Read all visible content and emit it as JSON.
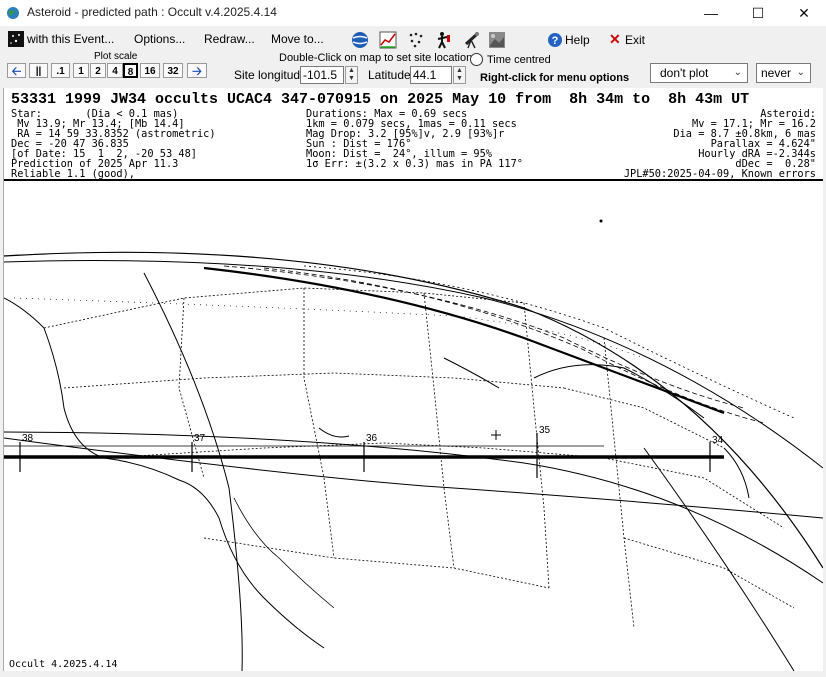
{
  "window": {
    "title": "Asteroid - predicted path : Occult v.4.2025.4.14"
  },
  "menu": {
    "with_event": "with this Event...",
    "options": "Options...",
    "redraw": "Redraw...",
    "move_to": "Move to...",
    "help": "Help",
    "exit": "Exit"
  },
  "controls": {
    "plot_scale_label": "Plot scale",
    "scale_buttons": [
      ".1",
      "1",
      "2",
      "4",
      "8",
      "16",
      "32"
    ],
    "selected_scale": "8",
    "dblclick_hint": "Double-Click on map to set site location",
    "time_centred": "Time centred",
    "site_longitude_label": "Site longitude",
    "site_longitude": "-101.5",
    "latitude_label": "Latitude",
    "latitude": "44.1",
    "rightclick_hint": "Right-click for menu options",
    "plot_select": "don't plot",
    "never_select": "never"
  },
  "event": {
    "title": "53331 1999 JW34 occults UCAC4 347-070915 on 2025 May 10 from  8h 34m to  8h 43m UT",
    "star_lines": [
      "Star:       (Dia < 0.1 mas)",
      " Mv 13.9; Mr 13.4; [Mb 14.4]",
      " RA = 14 59 33.8352 (astrometric)",
      "Dec = -20 47 36.835",
      "[of Date: 15  1  2, -20 53 48]",
      "Prediction of 2025 Apr 11.3",
      "Reliable 1.1 (good),"
    ],
    "mid_lines": [
      "Durations: Max = 0.69 secs",
      "1km = 0.079 secs, 1mas = 0.11 secs",
      "Mag Drop: 3.2 [95%]v, 2.9 [93%]r",
      "Sun : Dist = 176°",
      "Moon: Dist =  24°, illum = 95%",
      "1σ Err: ±(3.2 x 0.3) mas in PA 117°"
    ],
    "asteroid_lines": [
      "Asteroid:",
      "Mv = 17.1; Mr = 16.2",
      "Dia = 8.7 ±0.8km, 6 mas",
      "Parallax = 4.624\"",
      "Hourly dRA =-2.344s",
      "dDec =  0.28\"",
      "JPL#50:2025-04-09, Known errors"
    ]
  },
  "map": {
    "time_marks": [
      "38",
      "37",
      "36",
      "35",
      "34"
    ],
    "footer": "Occult 4.2025.4.14"
  }
}
